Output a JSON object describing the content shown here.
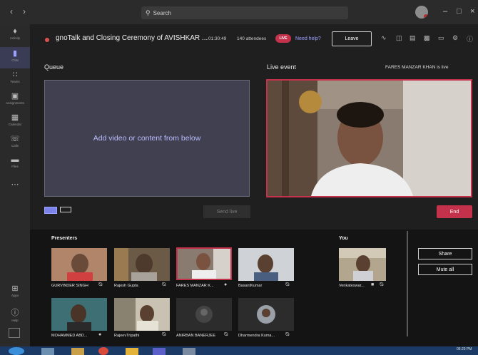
{
  "search": {
    "placeholder": "Search"
  },
  "rail": [
    {
      "icon": "bell-icon",
      "label": "Activity"
    },
    {
      "icon": "chat-icon",
      "label": "Chat"
    },
    {
      "icon": "teams-icon",
      "label": "Teams"
    },
    {
      "icon": "assignments-icon",
      "label": "Assignments"
    },
    {
      "icon": "calendar-icon",
      "label": "Calendar"
    },
    {
      "icon": "calls-icon",
      "label": "Calls"
    },
    {
      "icon": "files-icon",
      "label": "Files"
    }
  ],
  "rail_bottom": [
    {
      "icon": "apps-icon",
      "label": "Apps"
    },
    {
      "icon": "help-icon",
      "label": "Help"
    }
  ],
  "meeting": {
    "title": "gnoTalk and Closing Ceremony of AVISHKAR ...",
    "elapsed": "01:30:49",
    "attendees": "140 attendees",
    "live_badge": "LIVE",
    "help_link": "Need help?",
    "leave_label": "Leave"
  },
  "queue": {
    "heading": "Queue",
    "placeholder": "Add video or content from below",
    "send_live_label": "Send live"
  },
  "live": {
    "heading": "Live event",
    "status": "FARES MANZAR KHAN is live",
    "end_label": "End"
  },
  "presenters": {
    "heading": "Presenters",
    "items": [
      {
        "name": "GURVINDER SINGH",
        "selected": false
      },
      {
        "name": "Rajesh Gupta",
        "selected": false
      },
      {
        "name": "FARES MANZAR K...",
        "selected": true
      },
      {
        "name": "BasantKumar",
        "selected": false
      },
      {
        "name": "MOHAMMED ABD...",
        "selected": false
      },
      {
        "name": "RajeevTripathi",
        "selected": false
      },
      {
        "name": "ANIRBAN BANERJEE",
        "selected": false
      },
      {
        "name": "Dharmendra Kuma...",
        "selected": false
      }
    ]
  },
  "you": {
    "heading": "You",
    "name": "Venkateswar..."
  },
  "side_buttons": {
    "share": "Share",
    "mute_all": "Mute all"
  },
  "taskbar": {
    "time": "05:23 PM"
  },
  "colors": {
    "accent": "#7b83eb",
    "live": "#c4314b",
    "background": "#1f1f1f"
  }
}
